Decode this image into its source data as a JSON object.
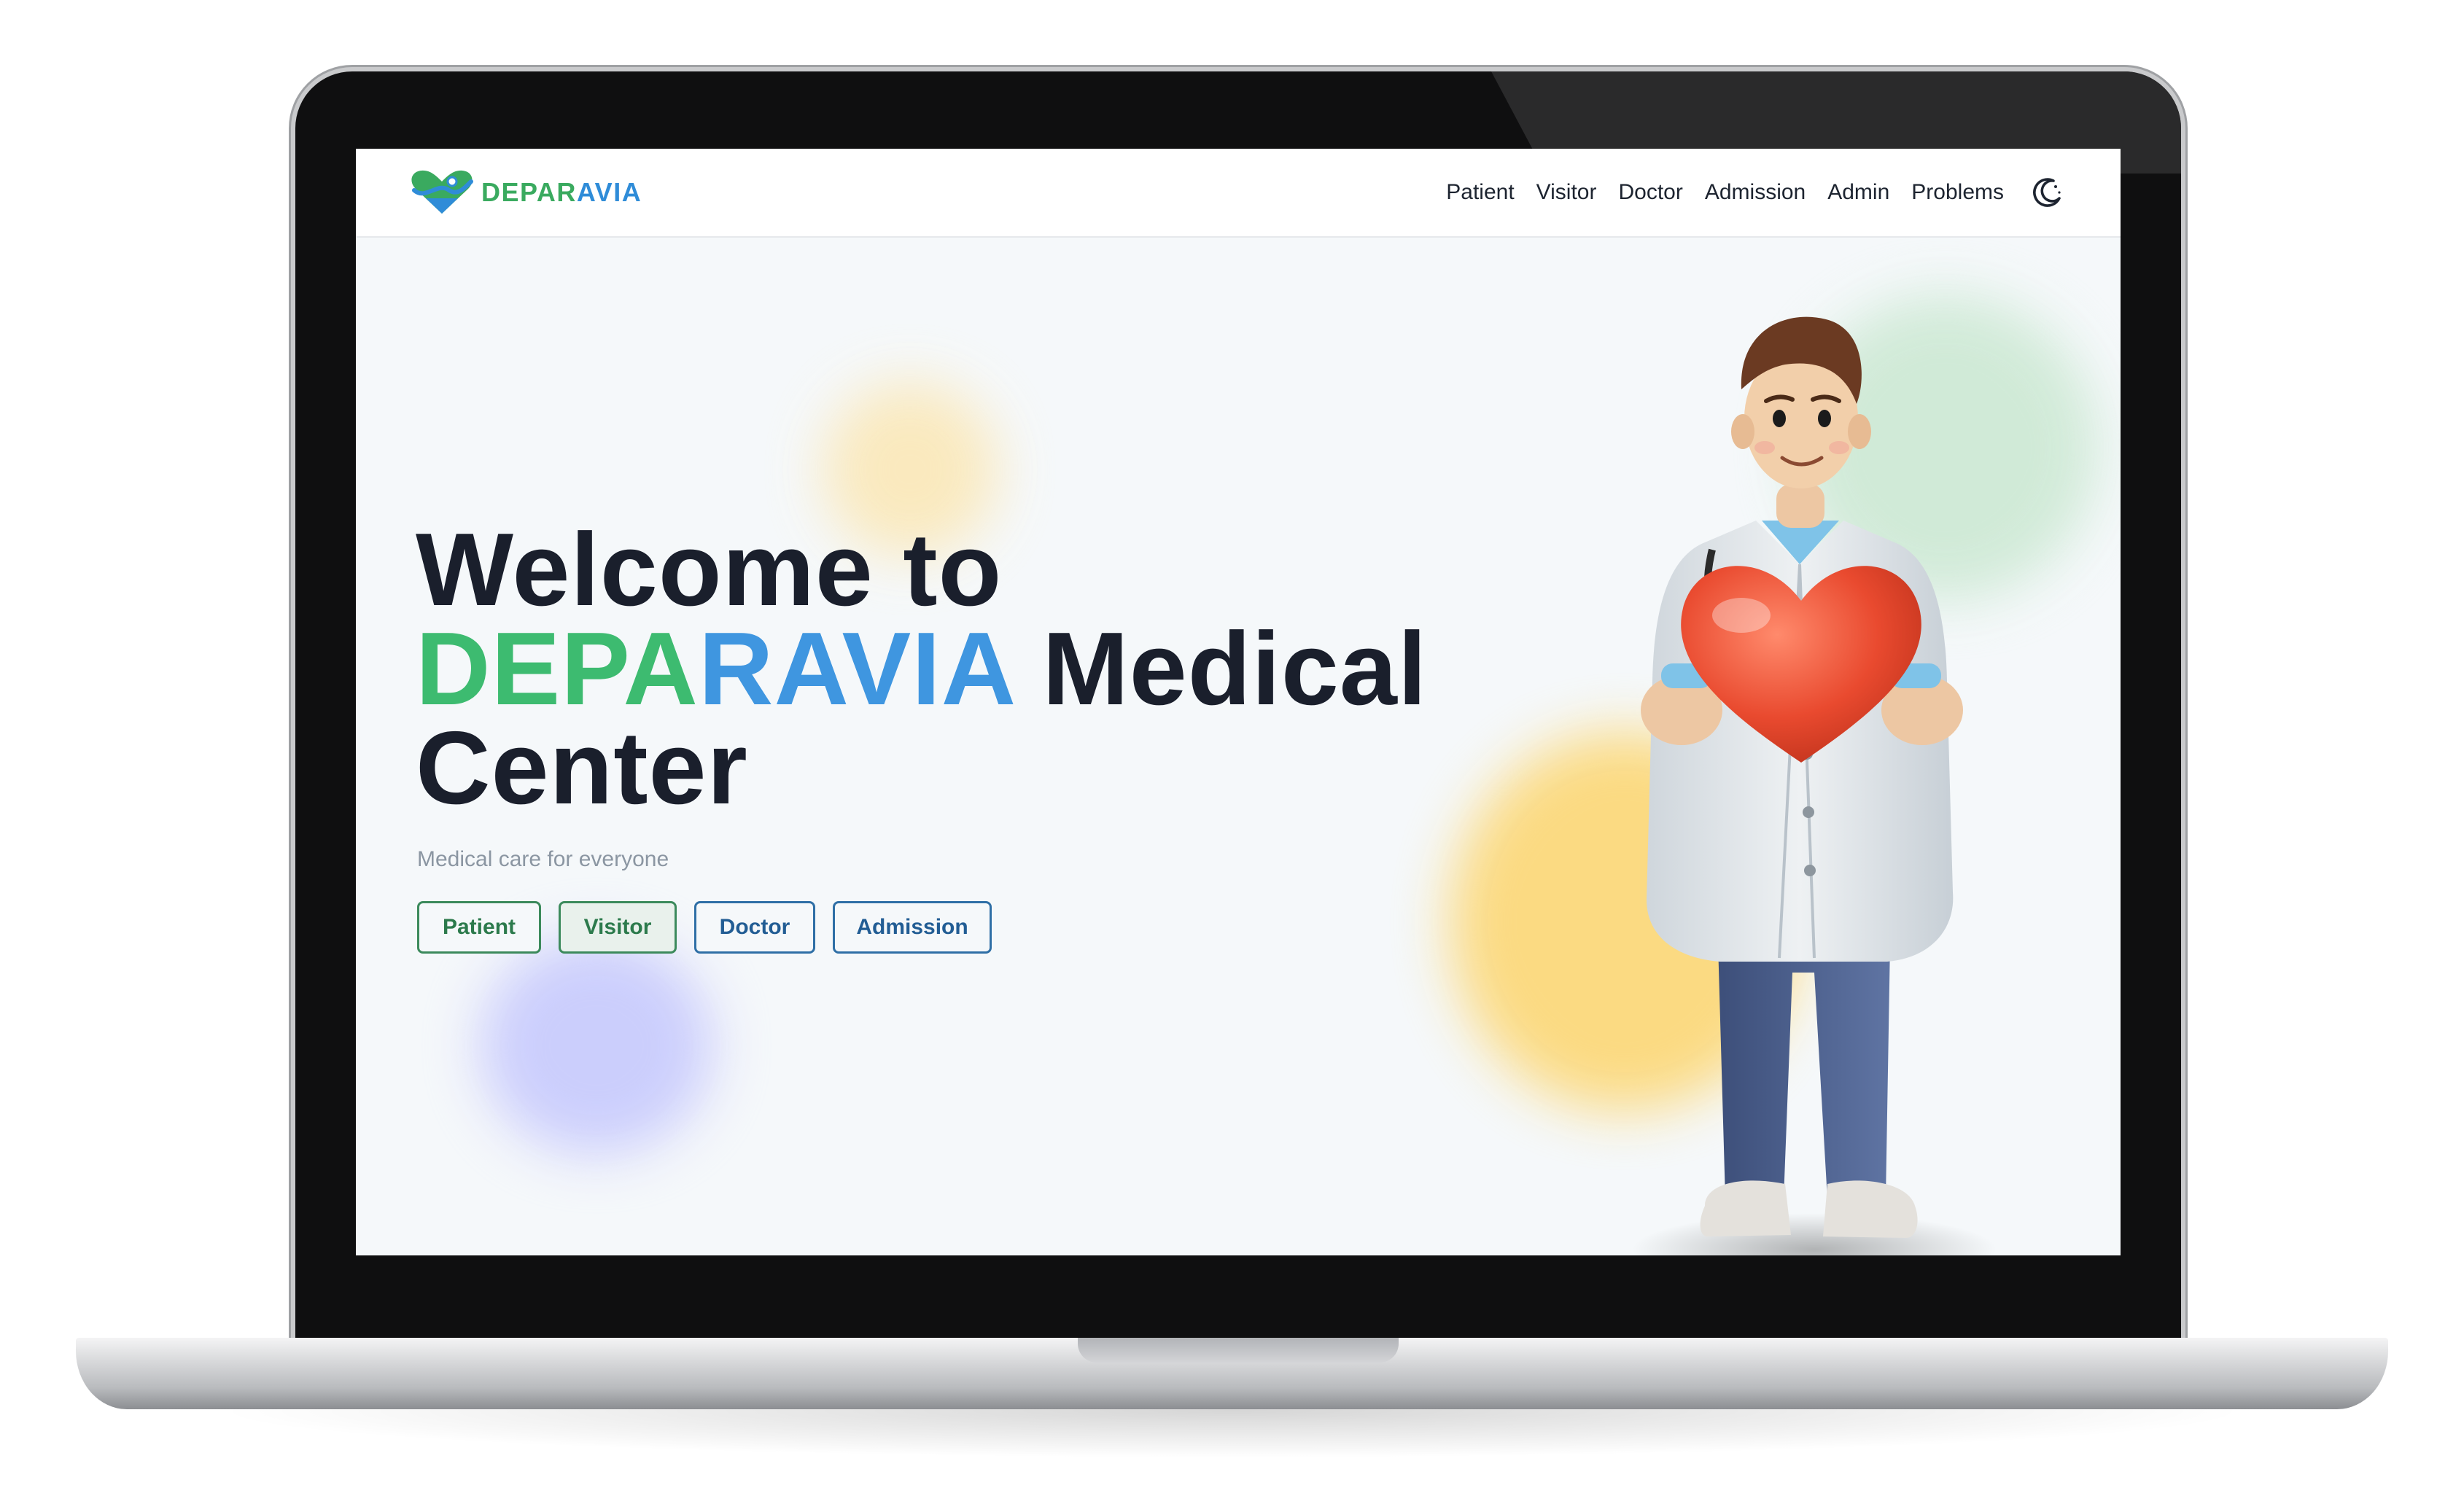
{
  "brand": {
    "name_green": "DEPAR",
    "name_blue": "AVIA",
    "logo_icon": "heart-logo-icon"
  },
  "nav": {
    "items": [
      "Patient",
      "Visitor",
      "Doctor",
      "Admission",
      "Admin",
      "Problems"
    ],
    "theme_toggle_icon": "moon-icon"
  },
  "hero": {
    "title_line1": "Welcome to",
    "title_brand_green": "DEPA",
    "title_brand_blue": "RAVIA",
    "title_line2_rest": " Medical",
    "title_line3": "Center",
    "subtitle": "Medical care for everyone",
    "buttons": [
      "Patient",
      "Visitor",
      "Doctor",
      "Admission"
    ],
    "illustration": "doctor-holding-heart-illustration"
  },
  "colors": {
    "brand_green": "#3dbb70",
    "brand_blue": "#3f96e0",
    "heading": "#1a1f2c",
    "page_bg": "#f5f8fa"
  }
}
